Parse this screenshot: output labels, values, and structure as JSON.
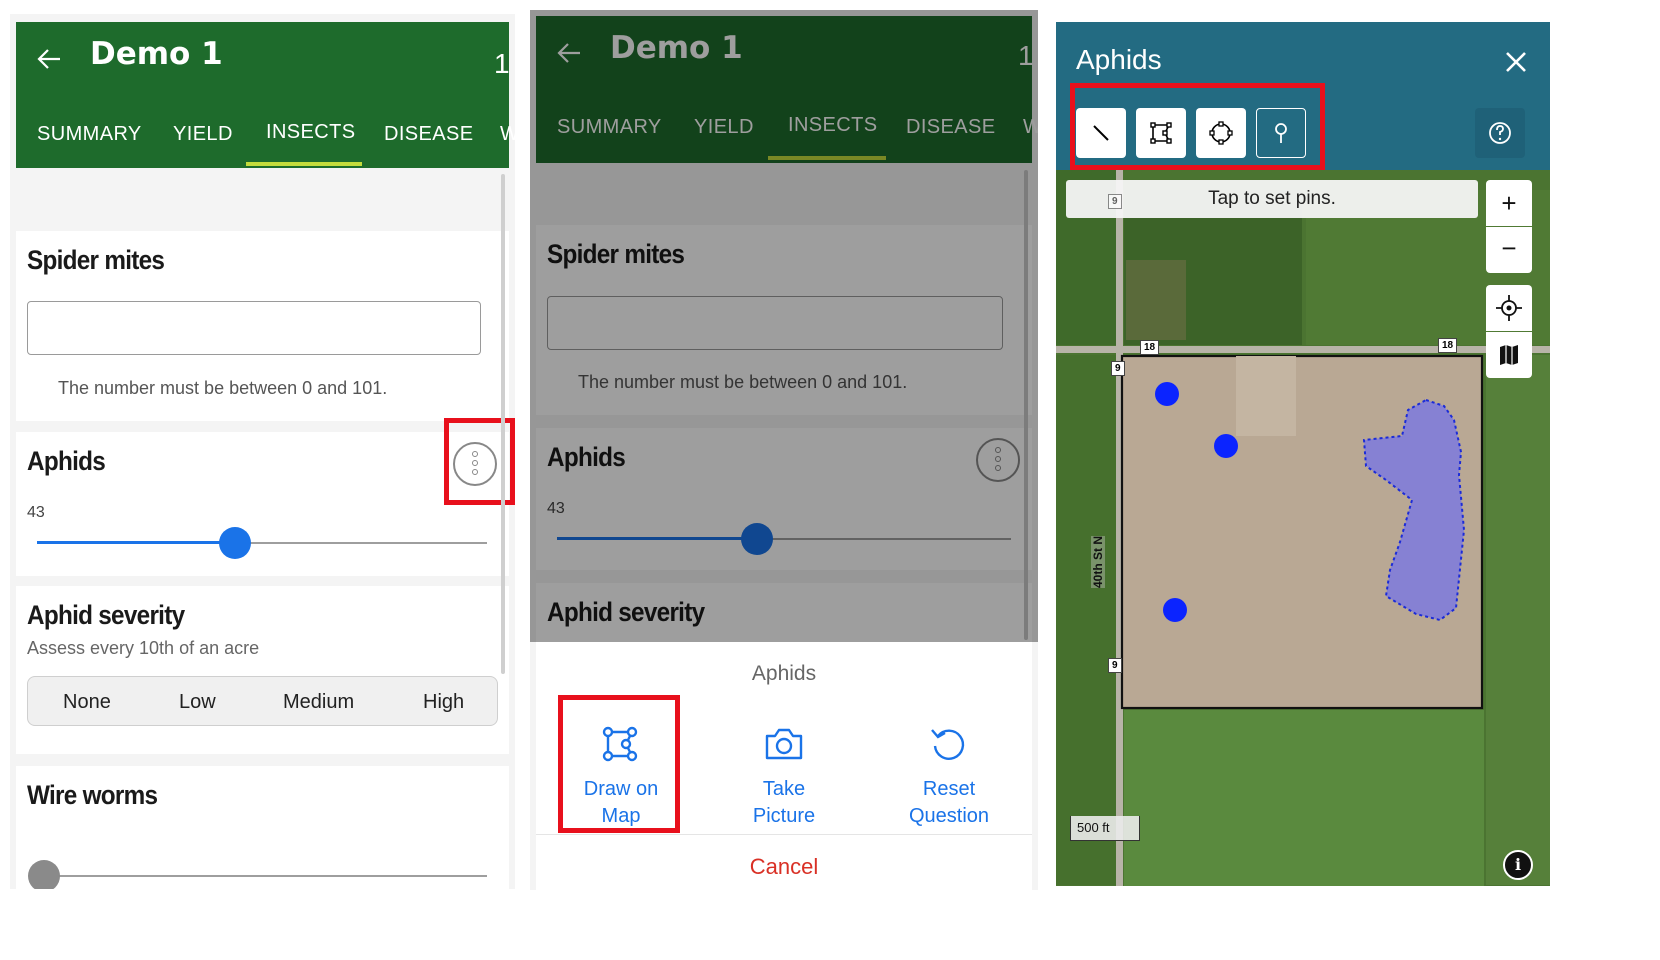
{
  "colors": {
    "header_green": "#1e6b2c",
    "tab_indicator": "#c4dc3c",
    "accent_blue": "#1a73e8",
    "map_header": "#236b82",
    "highlight_red": "#e8101c",
    "cancel_red": "#d93025"
  },
  "app": {
    "title": "Demo 1",
    "header_number": "1",
    "back_icon": "arrow-left-icon",
    "tabs": [
      "SUMMARY",
      "YIELD",
      "INSECTS",
      "DISEASE",
      "W"
    ],
    "active_tab": "INSECTS"
  },
  "form": {
    "spider_mites": {
      "title": "Spider mites",
      "value": "",
      "hint": "The number must be between 0 and 101."
    },
    "aphids": {
      "title": "Aphids",
      "value": "43",
      "slider_fraction": 0.44,
      "more_icon": "more-vertical-icon"
    },
    "aphid_severity": {
      "title": "Aphid severity",
      "subtitle": "Assess every 10th of an acre",
      "options": [
        "None",
        "Low",
        "Medium",
        "High"
      ]
    },
    "wire_worms": {
      "title": "Wire worms"
    }
  },
  "sheet": {
    "title": "Aphids",
    "actions": [
      {
        "line1": "Draw on",
        "line2": "Map",
        "icon": "draw-polygon-icon"
      },
      {
        "line1": "Take",
        "line2": "Picture",
        "icon": "camera-icon"
      },
      {
        "line1": "Reset",
        "line2": "Question",
        "icon": "reset-icon"
      }
    ],
    "cancel": "Cancel"
  },
  "map": {
    "title": "Aphids",
    "close_icon": "close-icon",
    "tools": [
      "line-tool-icon",
      "polygon-tool-icon",
      "circle-tool-icon",
      "pin-tool-icon"
    ],
    "active_tool": "pin-tool-icon",
    "help_icon": "help-icon",
    "banner": "Tap to set pins.",
    "zoom_in": "+",
    "zoom_out": "−",
    "locate_icon": "locate-icon",
    "layers_icon": "map-layers-icon",
    "road_label": "40th St N",
    "route_badges": [
      "18",
      "18",
      "9",
      "9",
      "9"
    ],
    "scale": "500 ft",
    "info_icon": "info-icon"
  }
}
